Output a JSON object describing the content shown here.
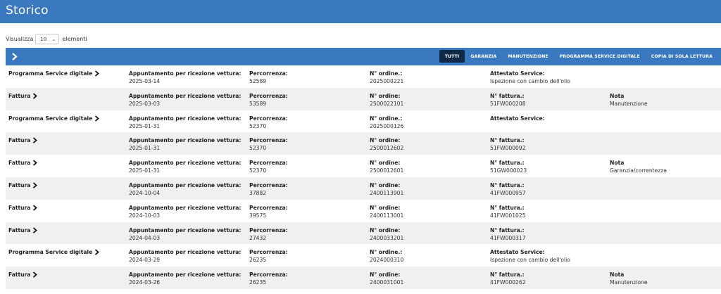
{
  "page": {
    "title": "Storico"
  },
  "length_control": {
    "prefix": "Visualizza",
    "value": "10",
    "suffix": "elementi"
  },
  "filters": [
    {
      "label": "Tutti",
      "active": true
    },
    {
      "label": "Garanzia",
      "active": false
    },
    {
      "label": "Manutenzione",
      "active": false
    },
    {
      "label": "Programma Service Digitale",
      "active": false
    },
    {
      "label": "Copia di sola lettura",
      "active": false
    }
  ],
  "rows": [
    {
      "type": "Programma Service digitale",
      "appt_label": "Appuntamento per ricezione vettura:",
      "appt": "2025-03-14",
      "km_label": "Percorrenza:",
      "km": "52589",
      "num_label": "N° ordine.:",
      "num": "2025000221",
      "ref_label": "Attestato Service:",
      "ref": "Ispezione con cambio dell'olio",
      "note_label": "",
      "note": ""
    },
    {
      "type": "Fattura",
      "appt_label": "Appuntamento per ricezione vettura:",
      "appt": "2025-03-03",
      "km_label": "Percorrenza:",
      "km": "53589",
      "num_label": "N° ordine:",
      "num": "2500022101",
      "ref_label": "N° fattura.:",
      "ref": "51FW000208",
      "note_label": "Nota",
      "note": "Manutenzione"
    },
    {
      "type": "Programma Service digitale",
      "appt_label": "Appuntamento per ricezione vettura:",
      "appt": "2025-01-31",
      "km_label": "Percorrenza:",
      "km": "52370",
      "num_label": "N° ordine.:",
      "num": "2025000126",
      "ref_label": "Attestato Service:",
      "ref": "",
      "note_label": "",
      "note": ""
    },
    {
      "type": "Fattura",
      "appt_label": "Appuntamento per ricezione vettura:",
      "appt": "2025-01-31",
      "km_label": "Percorrenza:",
      "km": "52370",
      "num_label": "N° ordine:",
      "num": "2500012602",
      "ref_label": "N° fattura.:",
      "ref": "51FW000092",
      "note_label": "",
      "note": ""
    },
    {
      "type": "Fattura",
      "appt_label": "Appuntamento per ricezione vettura:",
      "appt": "2025-01-31",
      "km_label": "Percorrenza:",
      "km": "52370",
      "num_label": "N° ordine:",
      "num": "2500012601",
      "ref_label": "N° fattura.:",
      "ref": "51GW000023",
      "note_label": "Nota",
      "note": "Garanzia/correntezza"
    },
    {
      "type": "Fattura",
      "appt_label": "Appuntamento per ricezione vettura:",
      "appt": "2024-10-04",
      "km_label": "Percorrenza:",
      "km": "37882",
      "num_label": "N° ordine:",
      "num": "2400113901",
      "ref_label": "N° fattura.:",
      "ref": "41FW000957",
      "note_label": "",
      "note": ""
    },
    {
      "type": "Fattura",
      "appt_label": "Appuntamento per ricezione vettura:",
      "appt": "2024-10-03",
      "km_label": "Percorrenza:",
      "km": "39575",
      "num_label": "N° ordine:",
      "num": "2400113001",
      "ref_label": "N° fattura.:",
      "ref": "41FW001025",
      "note_label": "",
      "note": ""
    },
    {
      "type": "Fattura",
      "appt_label": "Appuntamento per ricezione vettura:",
      "appt": "2024-04-03",
      "km_label": "Percorrenza:",
      "km": "27432",
      "num_label": "N° ordine:",
      "num": "2400033201",
      "ref_label": "N° fattura.:",
      "ref": "41FW000317",
      "note_label": "",
      "note": ""
    },
    {
      "type": "Programma Service digitale",
      "appt_label": "Appuntamento per ricezione vettura:",
      "appt": "2024-03-29",
      "km_label": "Percorrenza:",
      "km": "26235",
      "num_label": "N° ordine.:",
      "num": "2024000310",
      "ref_label": "Attestato Service:",
      "ref": "Ispezione con cambio dell'olio",
      "note_label": "",
      "note": ""
    },
    {
      "type": "Fattura",
      "appt_label": "Appuntamento per ricezione vettura:",
      "appt": "2024-03-26",
      "km_label": "Percorrenza:",
      "km": "26235",
      "num_label": "N° ordine:",
      "num": "2400031001",
      "ref_label": "N° fattura.:",
      "ref": "41FW000262",
      "note_label": "Nota",
      "note": "Manutenzione"
    }
  ],
  "icons": {
    "expand": "chevron-right-icon",
    "row_link": "chevron-right-icon",
    "select_caret": "chevron-down-icon"
  },
  "colors": {
    "header": "#3a78bf",
    "filter_active": "#0e2a47",
    "row_alt": "#eef0f2"
  }
}
